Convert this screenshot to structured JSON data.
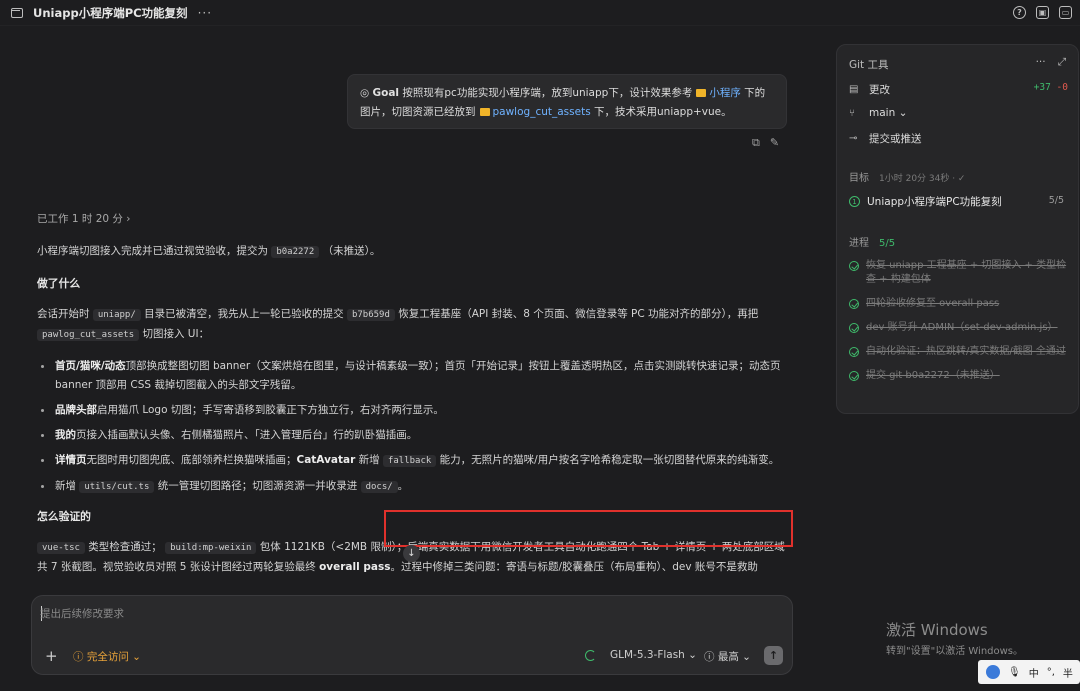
{
  "window": {
    "title": "Uniapp小程序端PC功能复刻",
    "more": "···",
    "help_icon": "?",
    "panel_icon": "▣",
    "layout_icon": "▭"
  },
  "goal_bubble": {
    "tag": "Goal",
    "text_1": "按照现有pc功能实现小程序端，放到uniapp下，设计效果参考",
    "folder_1": "小程序",
    "text_2": "下的",
    "text_3": "图片，切图资源已经放到",
    "folder_2": "pawlog_cut_assets",
    "text_4": "下，技术采用uniapp+vue。"
  },
  "bubble_actions": {
    "copy": "⧉",
    "edit": "✎"
  },
  "worked": "已工作 1 时 20 分 ›",
  "content": {
    "p1_a": "小程序端切图接入完成并已通过视觉验收，提交为",
    "p1_code": "b0a2272",
    "p1_b": "（未推送）。",
    "h_done": "做了什么",
    "p2_a": "会话开始时",
    "p2_code1": "uniapp/",
    "p2_b": "目录已被清空，我先从上一轮已验收的提交",
    "p2_code2": "b7b659d",
    "p2_c": "恢复工程基座（API 封装、8 个页面、微信登录等 PC 功能对齐的部分），再把",
    "p2_code3": "pawlog_cut_assets",
    "p2_d": "切图接入 UI：",
    "li1_b": "首页/猫咪/动态",
    "li1_t": "顶部换成整图切图 banner（文案烘焙在图里，与设计稿素级一致）；首页「开始记录」按钮上覆盖透明热区，点击实测跳转快速记录；动态页 banner 顶部用 CSS 裁掉切图截入的头部文字残留。",
    "li2_b": "品牌头部",
    "li2_t": "启用猫爪 Logo 切图；手写寄语移到胶囊正下方独立行，右对齐两行显示。",
    "li3_b": "我的",
    "li3_t": "页接入插画默认头像、右侧橘猫照片、「进入管理后台」行的趴卧猫插画。",
    "li4_b": "详情页",
    "li4_t1": "无图时用切图兜底、底部领养栏换猫咪插画；",
    "li4_b2": "CatAvatar",
    "li4_t2": "新增",
    "li4_code": "fallback",
    "li4_t3": "能力，无照片的猫咪/用户按名字哈希稳定取一张切图替代原来的纯渐变。",
    "li5_t1": "新增",
    "li5_code1": "utils/cut.ts",
    "li5_t2": "统一管理切图路径；切图源资源一并收录进",
    "li5_code2": "docs/",
    "li5_t3": "。",
    "h_verify": "怎么验证的",
    "p3_code1": "vue-tsc",
    "p3_a": "类型检查通过；",
    "p3_code2": "build:mp-weixin",
    "p3_b": "包体 1121KB（<2MB 限制）；后端真实数据下用微信开发者工具自动化跑通四个 Tab + 详情页 + 两处底部区域共 7 张截图。视觉验收员对照 5 张设计图经过两轮复验最终",
    "p3_bold": "overall pass",
    "p3_c": "。过程中修掉三类问题：寄语与标题/胶囊叠压（布局重构）、dev 账号不是救助"
  },
  "composer": {
    "placeholder": "提出后续修改要求",
    "plus": "+",
    "access": "ⓘ 完全访问 ⌄",
    "model": "GLM-5.3-Flash ⌄",
    "effort": "ⓘ 最高 ⌄",
    "send": "↑"
  },
  "panel": {
    "title": "Git 工具",
    "head_more": "···",
    "head_expand": "⤢",
    "changes_label": "更改",
    "diff_add": "+37",
    "diff_del": "-0",
    "branch": "main ⌄",
    "commit_label": "提交或推送",
    "goal_section": "目标",
    "goal_elapsed": "1小时 20分 34秒 · ✓",
    "goal_item": "Uniapp小程序端PC功能复刻",
    "goal_num": "1",
    "goal_count": "5/5",
    "progress_section": "进程",
    "progress_count": "5/5",
    "progress_items": [
      "恢复 uniapp 工程基座 + 切图接入 + 类型检查 + 构建包体",
      "四轮验收修复至 overall pass",
      "dev 账号升 ADMIN（set-dev-admin.js）",
      "自动化验证：热区跳转/真实数据/截图 全通过",
      "提交 git b0a2272（未推送）"
    ]
  },
  "windows": {
    "activate_title": "激活 Windows",
    "activate_sub": "转到\"设置\"以激活 Windows。",
    "ime_mic": "🎙",
    "ime_lang": "中",
    "ime_punct": "°,",
    "ime_half": "半"
  },
  "colors": {
    "accent_green": "#3fba6b",
    "diff_red": "#e25a4f",
    "highlight_red": "#e0312c",
    "link_blue": "#6fb2ff",
    "folder_yellow": "#f0b429"
  }
}
